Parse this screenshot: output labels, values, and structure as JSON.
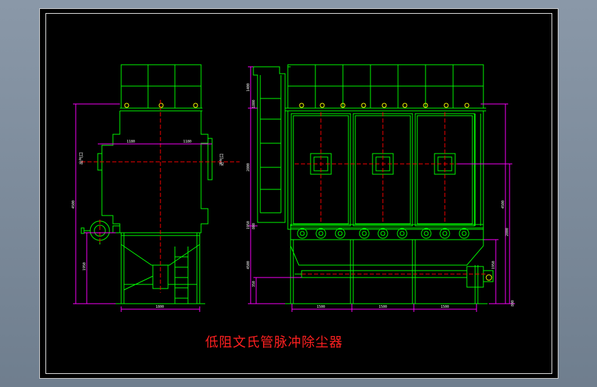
{
  "drawing": {
    "title": "低阻文氏管脉冲除尘器",
    "colors": {
      "background": "#000000",
      "structure": "#00ff00",
      "dimension": "#ff00ff",
      "centerline": "#ff0000",
      "frame": "#e8e8e8",
      "title": "#ff2020"
    },
    "side_view": {
      "outlet_label": "出气口",
      "inlet_label": "进气口",
      "dim_left": "1180",
      "dim_right": "1180",
      "dim_total_height": "4500",
      "dim_support_height": "1950",
      "dim_width": "1800"
    },
    "front_view": {
      "dim_1": "1400",
      "dim_2": "1800",
      "dim_3": "2800",
      "dim_4": "1950",
      "dim_5": "800",
      "dim_6": "4500",
      "dim_7": "350",
      "bay_width_1": "1500",
      "bay_width_2": "1500",
      "bay_width_3": "1500",
      "dim_right_1": "4500",
      "dim_right_2": "2800",
      "dim_right_3": "1950",
      "dim_right_4": "800"
    }
  }
}
